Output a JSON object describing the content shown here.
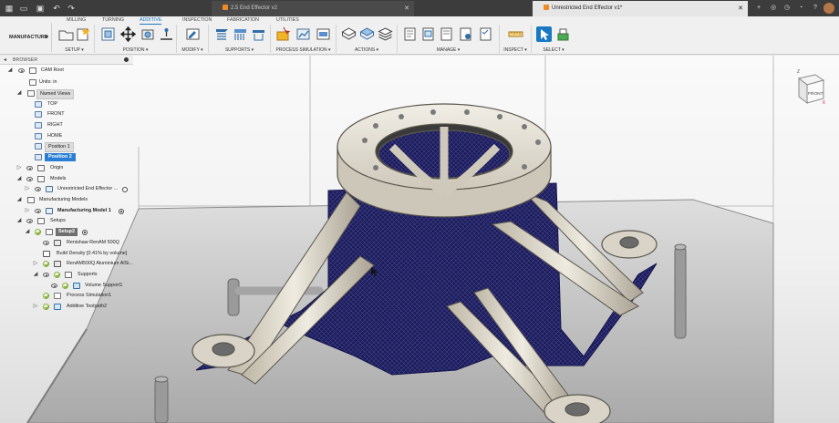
{
  "titlebar": {
    "tabs": [
      {
        "label": "2.5 End Effector v2",
        "active": false
      },
      {
        "label": "Unrestricted End Effector v1*",
        "active": true
      }
    ],
    "icons": [
      "grid-icon",
      "file-icon",
      "save-icon",
      "undo-icon",
      "redo-icon",
      "plus-icon",
      "extensions-icon",
      "job-status-icon",
      "notifications-icon",
      "help-icon",
      "user-avatar-icon"
    ]
  },
  "toolbar": {
    "workspace": "MANUFACTURE",
    "workspace_tabs": [
      {
        "label": "MILLING",
        "active": false
      },
      {
        "label": "TURNING",
        "active": false
      },
      {
        "label": "ADDITIVE",
        "active": true
      },
      {
        "label": "INSPECTION",
        "active": false
      },
      {
        "label": "FABRICATION",
        "active": false
      },
      {
        "label": "UTILITIES",
        "active": false
      }
    ],
    "groups": [
      {
        "label": "SETUP ▾"
      },
      {
        "label": "POSITION ▾"
      },
      {
        "label": "MODIFY ▾"
      },
      {
        "label": "SUPPORTS ▾"
      },
      {
        "label": "PROCESS SIMULATION ▾"
      },
      {
        "label": "ACTIONS ▾"
      },
      {
        "label": "MANAGE ▾"
      },
      {
        "label": "INSPECT ▾"
      },
      {
        "label": "SELECT ▾"
      }
    ],
    "accent": "#1a78c2"
  },
  "browser": {
    "title": "BROWSER",
    "items": [
      {
        "label": "CAM Root"
      },
      {
        "label": "Units: in"
      },
      {
        "label": "Named Views"
      },
      {
        "label": "TOP"
      },
      {
        "label": "FRONT"
      },
      {
        "label": "RIGHT"
      },
      {
        "label": "HOME"
      },
      {
        "label": "Position 1"
      },
      {
        "label": "Position 2"
      },
      {
        "label": "Origin"
      },
      {
        "label": "Models"
      },
      {
        "label": "Unrestricted End Effector ..."
      },
      {
        "label": "Manufacturing Models"
      },
      {
        "label": "Manufacturing Model 1"
      },
      {
        "label": "Setups"
      },
      {
        "label": "Setup2"
      },
      {
        "label": "Renishaw RenAM 500Q"
      },
      {
        "label": "Build Density [0.41% by volume]"
      },
      {
        "label": "RenAM500Q Aluminium AlSi..."
      },
      {
        "label": "Supports"
      },
      {
        "label": "Volume Support1"
      },
      {
        "label": "Process Simulation1"
      },
      {
        "label": "Additive Toolpath2"
      }
    ]
  },
  "viewcube": {
    "face_label": "FRONT"
  }
}
